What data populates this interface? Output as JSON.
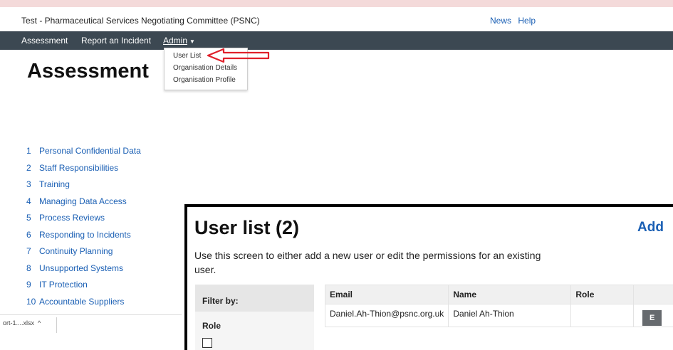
{
  "header": {
    "site_title": "Test - Pharmaceutical Services Negotiating Committee (PSNC)",
    "links": [
      "News",
      "Help"
    ]
  },
  "nav": {
    "assessment": "Assessment",
    "report_incident": "Report an Incident",
    "admin": "Admin",
    "caret_icon": "caret-down-icon"
  },
  "admin_menu": {
    "items": [
      "User List",
      "Organisation Details",
      "Organisation Profile"
    ],
    "annotation_color": "#e0202a"
  },
  "page": {
    "title": "Assessment",
    "sections": [
      {
        "num": "1",
        "label": "Personal Confidential Data"
      },
      {
        "num": "2",
        "label": "Staff Responsibilities"
      },
      {
        "num": "3",
        "label": "Training"
      },
      {
        "num": "4",
        "label": "Managing Data Access"
      },
      {
        "num": "5",
        "label": "Process Reviews"
      },
      {
        "num": "6",
        "label": "Responding to Incidents"
      },
      {
        "num": "7",
        "label": "Continuity Planning"
      },
      {
        "num": "8",
        "label": "Unsupported Systems"
      },
      {
        "num": "9",
        "label": "IT Protection"
      },
      {
        "num": "10",
        "label": "Accountable Suppliers"
      }
    ]
  },
  "download_bar": {
    "file_label": "ort-1....xlsx",
    "chevron": "^"
  },
  "user_list": {
    "title": "User list (2)",
    "add_label": "Add",
    "description": "Use this screen to either add a new user or edit the permissions for an existing user.",
    "filter": {
      "heading": "Filter by:",
      "role_label": "Role"
    },
    "columns": [
      "Email",
      "Name",
      "Role",
      ""
    ],
    "rows": [
      {
        "email": "Daniel.Ah-Thion@psnc.org.uk",
        "name": "Daniel Ah-Thion",
        "role": "",
        "action": "E"
      }
    ]
  }
}
